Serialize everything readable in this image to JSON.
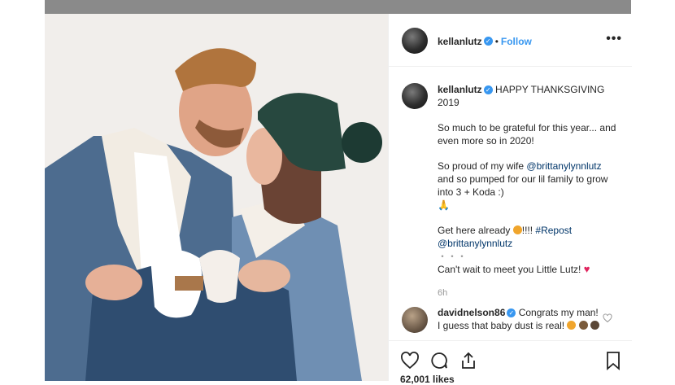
{
  "post": {
    "username": "kellanlutz",
    "follow_label": "Follow",
    "caption_lines": [
      "HAPPY THANKSGIVING 2019",
      "So much to be grateful for this year... and even more so in 2020!",
      "So proud of my wife",
      "@brittanylynnlutz",
      "and so pumped for our lil family to grow into 3 + Koda :)",
      "🙏",
      "Get here already",
      "!!!!",
      "#Repost",
      "@brittanylynnlutz",
      "・・・",
      "Can't wait to meet you Little Lutz!"
    ],
    "time": "6h",
    "comment": {
      "username": "davidnelson86",
      "text": "Congrats my man! I guess that baby dust is real!"
    },
    "likes": "62,001 likes"
  },
  "colors": {
    "link": "#3897f0",
    "mention": "#003569",
    "heart": "#e0245e"
  }
}
